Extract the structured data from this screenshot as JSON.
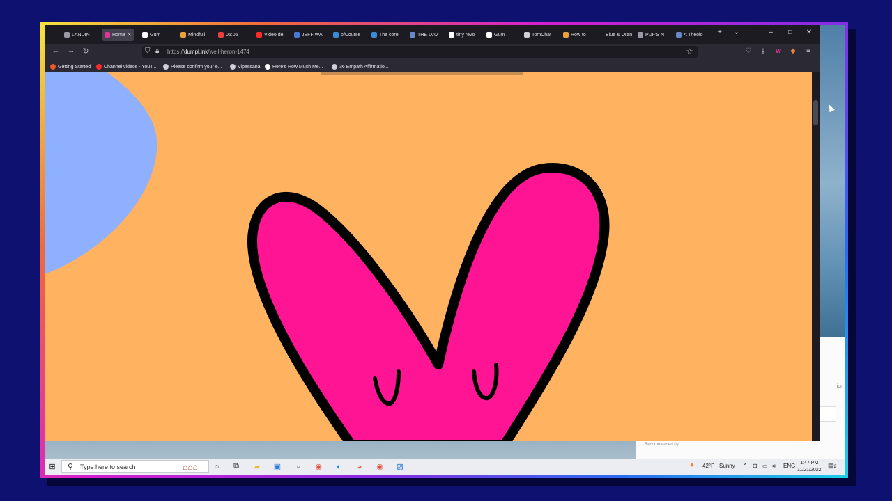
{
  "tabs": [
    {
      "label": "LANDIN",
      "color": "#9a9aa6"
    },
    {
      "label": "Home",
      "color": "#e0349a",
      "active": true
    },
    {
      "label": "Gum",
      "color": "#ffffff"
    },
    {
      "label": "Mindfull",
      "color": "#e8a040"
    },
    {
      "label": "05:05",
      "color": "#e84040"
    },
    {
      "label": "Video de",
      "color": "#ff2a2a"
    },
    {
      "label": "JEFF WA",
      "color": "#4a78d8"
    },
    {
      "label": "ofCourse",
      "color": "#3a8ad8"
    },
    {
      "label": "The core",
      "color": "#3a8ad8"
    },
    {
      "label": "THE DAV",
      "color": "#6a88c8"
    },
    {
      "label": "tiny revo",
      "color": "#ffffff"
    },
    {
      "label": "Gum",
      "color": "#ffffff"
    },
    {
      "label": "TomChat",
      "color": "#cfcfd8"
    },
    {
      "label": "How to",
      "color": "#e8a040"
    },
    {
      "label": "Blue & Oran",
      "color": "#1c1b22"
    },
    {
      "label": "PDF'S N",
      "color": "#9a9aa6"
    },
    {
      "label": "A Theolo",
      "color": "#6a88c8"
    }
  ],
  "window_controls": {
    "minimize": "–",
    "maximize": "□",
    "close": "✕"
  },
  "tab_extras": {
    "new_tab": "+",
    "list_all": "⌄",
    "close_tab": "✕"
  },
  "nav": {
    "back": "←",
    "forward": "→",
    "reload": "↻"
  },
  "url": {
    "prefix": "https://",
    "domain": "dumpl.ink",
    "path": "/well-heron-1474"
  },
  "bookmarks": [
    {
      "label": "Getting Started",
      "color": "#e85a2a"
    },
    {
      "label": "Channel videos - YouT...",
      "color": "#ff2a2a"
    },
    {
      "label": "Please confirm your e...",
      "color": "#cfcfd8"
    },
    {
      "label": "Vipassana",
      "color": "#cfcfd8"
    },
    {
      "label": "Here's How Much Me...",
      "color": "#ffffff"
    },
    {
      "label": "36 Empath Affirmatio...",
      "color": "#cfcfd8"
    }
  ],
  "page": {
    "background": "#ffb25f",
    "heart_color": "#ff1493",
    "blob_color": "#8fb0ff"
  },
  "side_panel": {
    "recommended": "Recommended by",
    "fragment": "ion"
  },
  "taskbar": {
    "search_placeholder": "Type here to search",
    "weather_temp": "42°F",
    "weather_text": "Sunny",
    "language": "ENG",
    "time": "1:47 PM",
    "date": "11/21/2022",
    "notifications": "2"
  }
}
